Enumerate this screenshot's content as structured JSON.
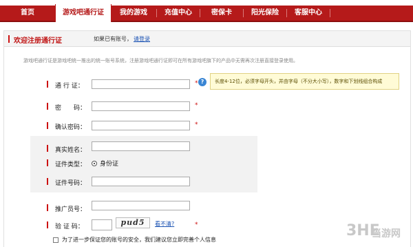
{
  "nav": {
    "items": [
      "首页",
      "游戏吧通行证",
      "我的游戏",
      "充值中心",
      "密保卡",
      "阳光保险",
      "客服中心"
    ]
  },
  "header": {
    "title": "欢迎注册通行证",
    "note": "如果已有账号，",
    "login_link": "请登录"
  },
  "intro": "游戏吧通行证是游戏吧统一推出的统一账号系统，注册游戏吧通行证即可在所有游戏吧旗下的产品中无需再次注册直接登录使用。",
  "form": {
    "account_label": "通 行 证：",
    "password_label": "密　　码：",
    "confirm_label": "确认密码：",
    "realname_label": "真实姓名：",
    "idtype_label": "证件类型：",
    "idtype_value": "身份证",
    "idnumber_label": "证件号码：",
    "promoter_label": "推广员号：",
    "captcha_label": "验 证 码：",
    "captcha_image_text": "pud5",
    "captcha_refresh": "看不清?",
    "star": "*",
    "checkbox_label": "为了进一步保证您的账号的安全，我们建议您立即完善个人信息"
  },
  "tip": "长度4-12位，必须字母开头，并由字母（不分大小写），数字和下划线组合构成",
  "watermark": {
    "logo": "3HE",
    "text": "当游网"
  }
}
